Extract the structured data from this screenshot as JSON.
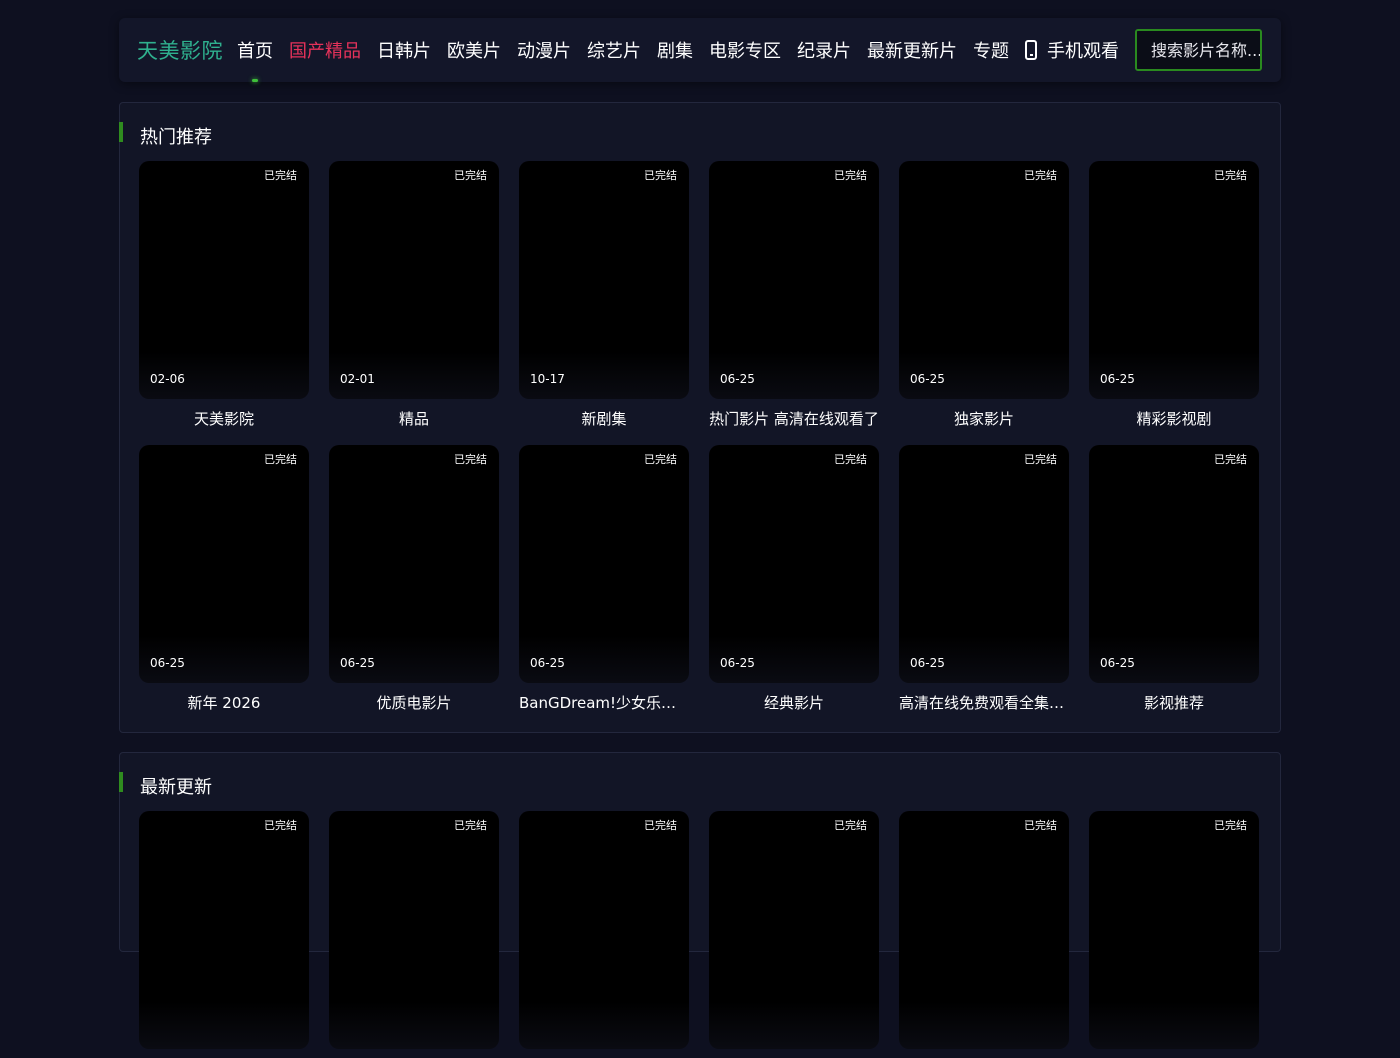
{
  "header": {
    "logo": "天美影院",
    "nav": [
      {
        "label": "首页",
        "active": false,
        "indicator": true
      },
      {
        "label": "国产精品",
        "active": true
      },
      {
        "label": "日韩片"
      },
      {
        "label": "欧美片"
      },
      {
        "label": "动漫片"
      },
      {
        "label": "综艺片"
      },
      {
        "label": "剧集"
      },
      {
        "label": "电影专区"
      },
      {
        "label": "纪录片"
      },
      {
        "label": "最新更新片"
      },
      {
        "label": "专题"
      },
      {
        "label": "手机观看",
        "icon": "phone-icon"
      }
    ],
    "search": {
      "placeholder": "搜索影片名称...",
      "button_icon": "search-icon"
    }
  },
  "sections": [
    {
      "title": "热门推荐",
      "items": [
        {
          "badge": "已完结",
          "date": "02-06",
          "title": "天美影院"
        },
        {
          "badge": "已完结",
          "date": "02-01",
          "title": "精品"
        },
        {
          "badge": "已完结",
          "date": "10-17",
          "title": "新剧集"
        },
        {
          "badge": "已完结",
          "date": "06-25",
          "title": "热门影片 高清在线观看了"
        },
        {
          "badge": "已完结",
          "date": "06-25",
          "title": "独家影片"
        },
        {
          "badge": "已完结",
          "date": "06-25",
          "title": "精彩影视剧"
        },
        {
          "badge": "已完结",
          "date": "06-25",
          "title": "新年 2026"
        },
        {
          "badge": "已完结",
          "date": "06-25",
          "title": "优质电影片"
        },
        {
          "badge": "已完结",
          "date": "06-25",
          "title": "BanGDream!少女乐团派对第二季"
        },
        {
          "badge": "已完结",
          "date": "06-25",
          "title": "经典影片"
        },
        {
          "badge": "已完结",
          "date": "06-25",
          "title": "高清在线免费观看全集完整"
        },
        {
          "badge": "已完结",
          "date": "06-25",
          "title": "影视推荐"
        }
      ]
    },
    {
      "title": "最新更新",
      "items": [
        {
          "badge": "已完结",
          "date": "",
          "title": ""
        },
        {
          "badge": "已完结",
          "date": "",
          "title": ""
        },
        {
          "badge": "已完结",
          "date": "",
          "title": ""
        },
        {
          "badge": "已完结",
          "date": "",
          "title": ""
        },
        {
          "badge": "已完结",
          "date": "",
          "title": ""
        },
        {
          "badge": "已完结",
          "date": "",
          "title": ""
        }
      ]
    }
  ],
  "colors": {
    "background": "#0e1020",
    "panel": "#121526",
    "accent_green": "#2f8c1f",
    "active_nav": "#e5325a",
    "logo": "#2fb08e"
  }
}
